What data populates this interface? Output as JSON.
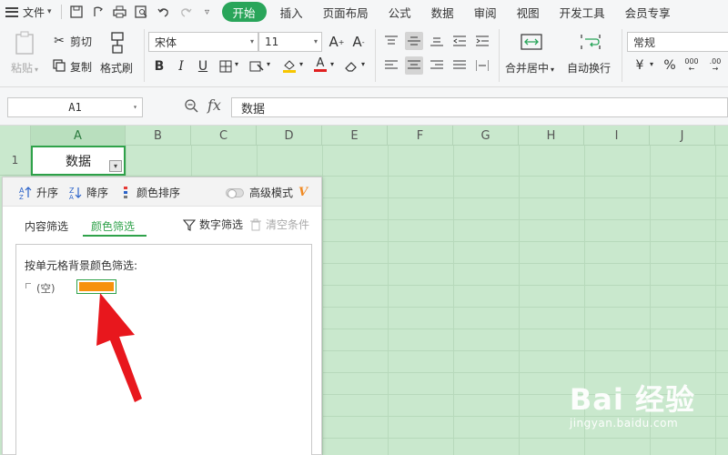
{
  "menubar": {
    "file_label": "文件",
    "tabs": [
      {
        "label": "开始",
        "active": true
      },
      {
        "label": "插入"
      },
      {
        "label": "页面布局"
      },
      {
        "label": "公式"
      },
      {
        "label": "数据"
      },
      {
        "label": "审阅"
      },
      {
        "label": "视图"
      },
      {
        "label": "开发工具"
      },
      {
        "label": "会员专享"
      }
    ]
  },
  "ribbon": {
    "paste_label": "粘贴",
    "cut_label": "剪切",
    "copy_label": "复制",
    "format_painter_label": "格式刷",
    "font_name": "宋体",
    "font_size": "11",
    "merge_center_label": "合并居中",
    "wrap_text_label": "自动换行",
    "number_format": "常规",
    "percent_symbol": "%",
    "currency_symbol": "¥"
  },
  "formula_bar": {
    "name_box": "A1",
    "fx_label": "fx",
    "formula": "数据"
  },
  "grid": {
    "columns": [
      "A",
      "B",
      "C",
      "D",
      "E",
      "F",
      "G",
      "H",
      "I",
      "J"
    ],
    "rows": [
      "1"
    ],
    "cell_a1": "数据"
  },
  "filter_panel": {
    "sort_asc": "升序",
    "sort_desc": "降序",
    "color_sort": "颜色排序",
    "advanced_mode": "高级模式",
    "advanced_logo": "V",
    "tab_content": "内容筛选",
    "tab_color": "颜色筛选",
    "number_filter": "数字筛选",
    "clear_condition": "清空条件",
    "hint": "按单元格背景颜色筛选:",
    "empty_option": "(空)",
    "swatch_color": "#f7920d"
  },
  "colors": {
    "accent": "#29a55a",
    "grid_bg": "#c9e8cd",
    "arrow": "#e8171d"
  },
  "watermark": {
    "main": "Bai 经验",
    "sub": "jingyan.baidu.com"
  }
}
